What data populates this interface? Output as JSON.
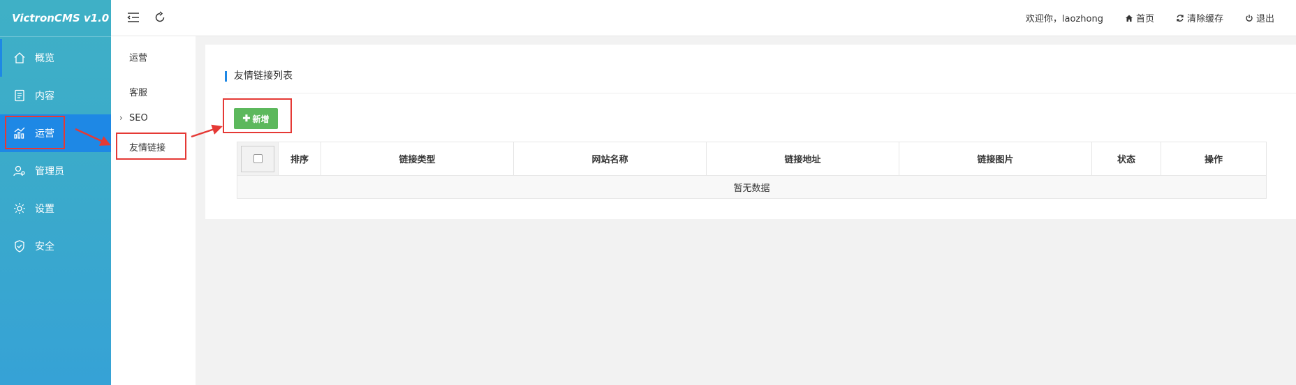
{
  "brand": "VictronCMS v1.0",
  "sidebar": {
    "items": [
      {
        "label": "概览",
        "icon": "home-icon"
      },
      {
        "label": "内容",
        "icon": "document-icon"
      },
      {
        "label": "运营",
        "icon": "chart-icon"
      },
      {
        "label": "管理员",
        "icon": "user-icon"
      },
      {
        "label": "设置",
        "icon": "gear-icon"
      },
      {
        "label": "安全",
        "icon": "shield-icon"
      }
    ]
  },
  "submenu": {
    "items": [
      {
        "label": "运营"
      },
      {
        "label": "客服"
      },
      {
        "label": "SEO",
        "chevron": "›"
      },
      {
        "label": "友情链接"
      }
    ]
  },
  "header": {
    "welcome": "欢迎你，laozhong",
    "home": "首页",
    "clear_cache": "清除缓存",
    "logout": "退出"
  },
  "card": {
    "title": "友情链接列表",
    "add_button": "新增",
    "add_icon": "✚"
  },
  "table": {
    "columns": [
      "排序",
      "链接类型",
      "网站名称",
      "链接地址",
      "链接图片",
      "状态",
      "操作"
    ],
    "empty_text": "暂无数据"
  },
  "colors": {
    "accent": "#1e88e5",
    "highlight": "#e53935",
    "add_button": "#5cb85c"
  }
}
